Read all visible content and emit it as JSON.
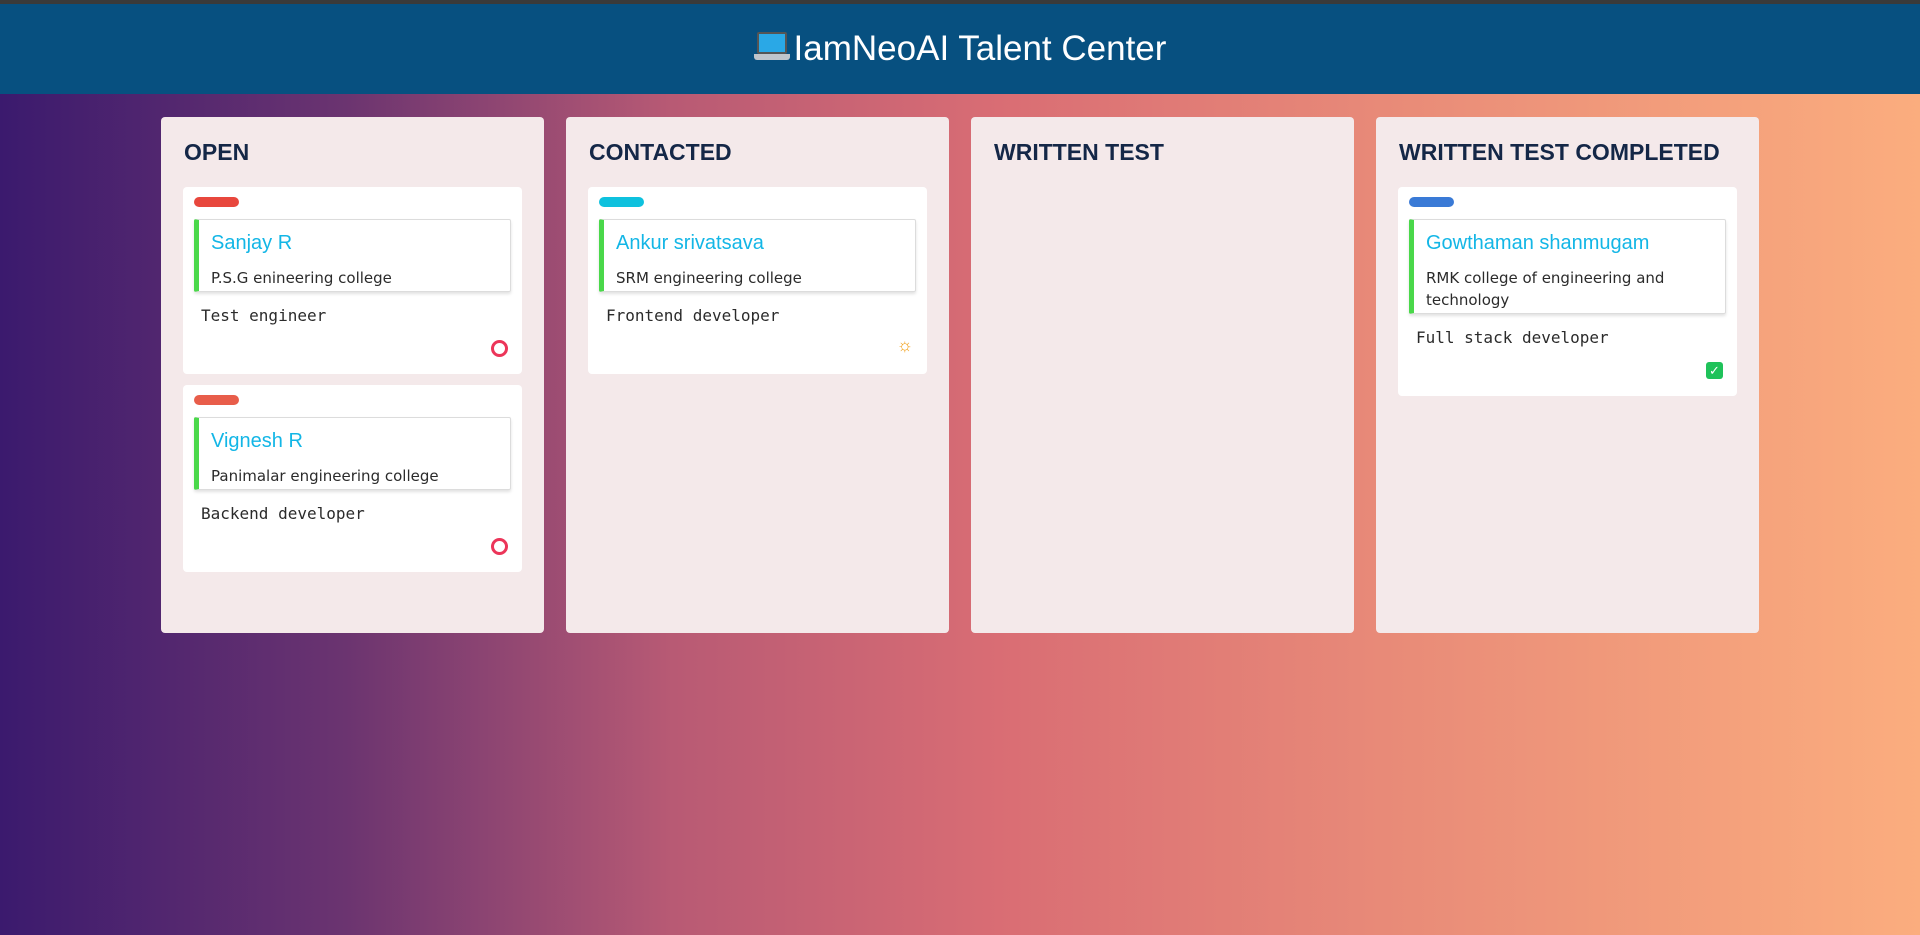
{
  "header": {
    "title": "IamNeoAI Talent Center",
    "icon": "laptop-icon"
  },
  "columns": [
    {
      "title": "OPEN",
      "cards": [
        {
          "tag_color": "#e8473d",
          "name": "Sanjay R",
          "college": "P.S.G enineering college",
          "role": "Test engineer",
          "status_icon": "circle-icon"
        },
        {
          "tag_color": "#e85d4a",
          "name": "Vignesh R",
          "college": "Panimalar engineering college",
          "role": "Backend developer",
          "status_icon": "circle-icon"
        }
      ]
    },
    {
      "title": "CONTACTED",
      "cards": [
        {
          "tag_color": "#0ec1de",
          "name": "Ankur srivatsava",
          "college": "SRM engineering college",
          "role": "Frontend developer",
          "status_icon": "sun-icon"
        }
      ]
    },
    {
      "title": "WRITTEN TEST",
      "cards": []
    },
    {
      "title": "WRITTEN TEST COMPLETED",
      "cards": [
        {
          "tag_color": "#3a7ad6",
          "name": "Gowthaman shanmugam",
          "college": "RMK college of engineering and technology",
          "role": "Full stack developer",
          "status_icon": "checkbox-icon"
        }
      ]
    }
  ]
}
